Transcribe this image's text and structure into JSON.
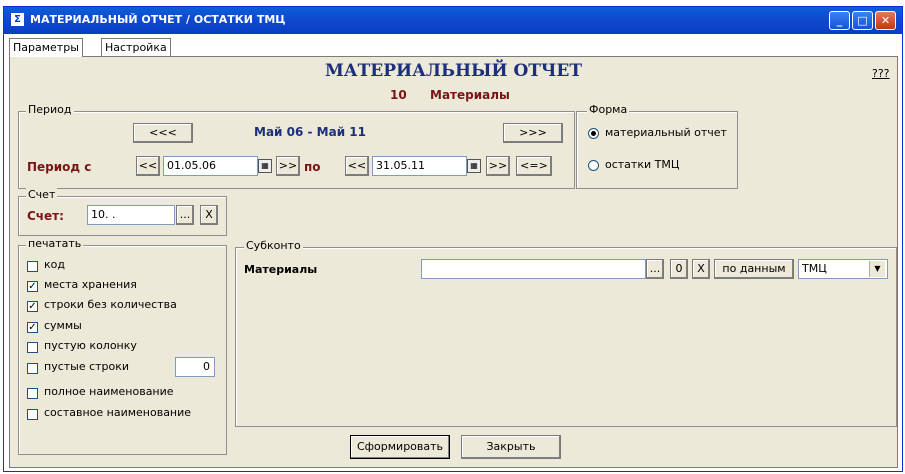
{
  "window": {
    "icon": "app-icon",
    "title": "МАТЕРИАЛЬНЫЙ ОТЧЕТ / ОСТАТКИ ТМЦ",
    "controls": [
      "minimize-icon",
      "maximize-icon",
      "close-icon"
    ]
  },
  "tabs": [
    {
      "label": "Параметры",
      "active": true
    },
    {
      "label": "Настройка",
      "active": false
    }
  ],
  "header": {
    "title": "МАТЕРИАЛЬНЫЙ ОТЧЕТ",
    "account_code": "10",
    "account_name": "Материалы",
    "help_label": "???"
  },
  "period": {
    "group_label": "Период",
    "prev_label": "<<<",
    "range_text": "Май 06 - Май 11",
    "next_label": ">>>",
    "from_label": "Период с",
    "from_prev": "<<",
    "from_value": "01.05.06",
    "from_next": ">>",
    "to_label": "по",
    "to_prev": "<<",
    "to_value": "31.05.11",
    "to_next": ">>",
    "swap_label": "<=>"
  },
  "form": {
    "group_label": "Форма",
    "options": [
      {
        "label": "материальный отчет",
        "selected": true
      },
      {
        "label": "остатки ТМЦ",
        "selected": false
      }
    ]
  },
  "account": {
    "group_label": "Счет",
    "label": "Счет:",
    "value": "10. .",
    "browse_label": "...",
    "clear_label": "X"
  },
  "print": {
    "group_label": "печатать",
    "items": [
      {
        "label": "код",
        "checked": false
      },
      {
        "label": "места хранения",
        "checked": true
      },
      {
        "label": "строки без количества",
        "checked": true
      },
      {
        "label": "суммы",
        "checked": true
      },
      {
        "label": "пустую колонку",
        "checked": false
      },
      {
        "label": "пустые строки",
        "checked": false
      },
      {
        "label": "полное наименование",
        "checked": false
      },
      {
        "label": "составное наименование",
        "checked": false
      }
    ],
    "empty_rows_value": "0"
  },
  "subconto": {
    "group_label": "Субконто",
    "row_label": "Материалы",
    "value": "",
    "browse_label": "...",
    "zero_label": "0",
    "clear_label": "X",
    "by_data_label": "по данным",
    "select_value": "ТМЦ"
  },
  "actions": {
    "generate_label": "Сформировать",
    "close_label": "Закрыть"
  }
}
